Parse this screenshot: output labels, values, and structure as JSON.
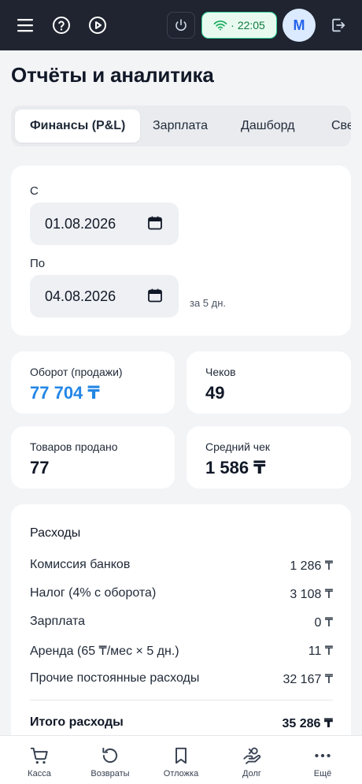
{
  "topbar": {
    "time": "22:05",
    "wifi_separator": "·",
    "avatar_initial": "M",
    "colors": {
      "background": "#1f2430",
      "wifi_pill": "#e8faf0",
      "wifi_accent": "#10a957"
    }
  },
  "page": {
    "title": "Отчёты и аналитика"
  },
  "tabs": [
    {
      "label": "Финансы (P&L)",
      "active": true
    },
    {
      "label": "Зарплата",
      "active": false
    },
    {
      "label": "Дашборд",
      "active": false
    },
    {
      "label": "Све",
      "active": false
    }
  ],
  "date_range": {
    "from_label": "С",
    "from_value": "01.08.2026",
    "to_label": "По",
    "to_value": "04.08.2026",
    "days_note": "за 5 дн."
  },
  "stats": {
    "turnover": {
      "label": "Оборот (продажи)",
      "value": "77 704 ₸"
    },
    "checks": {
      "label": "Чеков",
      "value": "49"
    },
    "items_sold": {
      "label": "Товаров продано",
      "value": "77"
    },
    "avg_check": {
      "label": "Средний чек",
      "value": "1 586 ₸"
    }
  },
  "expenses": {
    "title": "Расходы",
    "rows": [
      {
        "label": "Комиссия банков",
        "value": "1 286 ₸"
      },
      {
        "label": "Налог (4% с оборота)",
        "value": "3 108 ₸"
      },
      {
        "label": "Зарплата",
        "value": "0 ₸"
      },
      {
        "label": "Аренда (65 ₸/мес × 5 дн.)",
        "value": "11 ₸"
      },
      {
        "label": "Прочие постоянные расходы",
        "value": "32 167 ₸"
      }
    ],
    "total_label": "Итого расходы",
    "total_value": "35 286 ₸"
  },
  "bottom_nav": [
    {
      "label": "Касса",
      "icon": "cart-icon"
    },
    {
      "label": "Возвраты",
      "icon": "return-icon"
    },
    {
      "label": "Отложка",
      "icon": "bookmark-icon"
    },
    {
      "label": "Долг",
      "icon": "debt-hand-icon"
    },
    {
      "label": "Ещё",
      "icon": "more-icon"
    }
  ],
  "colors": {
    "accent": "#2386e6",
    "page_bg": "#f3f4f6",
    "card_bg": "#ffffff"
  }
}
